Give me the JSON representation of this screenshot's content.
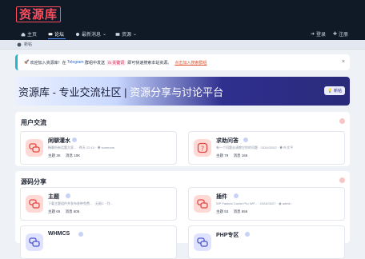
{
  "brand": {
    "logo": "资源库"
  },
  "header_actions": {
    "login": "登录",
    "register": "注册"
  },
  "nav": {
    "items": [
      {
        "label": "主页"
      },
      {
        "label": "论坛"
      },
      {
        "label": "最新消息"
      },
      {
        "label": "资源"
      }
    ]
  },
  "subbar": {
    "label": "新帖"
  },
  "notice": {
    "prefix": "欢迎加入资源库！在",
    "telegram": "Telegram",
    "middle": "群组中发送",
    "keyword": "/s 关键词",
    "suffix": "即可快速搜索本站资源。",
    "link": "点击加入搜索群组",
    "close": "×"
  },
  "banner": {
    "title_dark": "资源库 - 专业交流社区 | ",
    "title_light": "资源分享与讨论平台",
    "badge": "新帖"
  },
  "sections": [
    {
      "title": "用户交流",
      "cards": [
        {
          "name": "闲聊灌水",
          "desc": "畅聊所有话题大家...   · 昨天 22:10 · ◉ someone",
          "stats": [
            "主题 3K",
            "消息 10K"
          ]
        },
        {
          "name": "求助问答",
          "desc": "有一个问题去请教它你的问题 · 2024/02/02 · ◉ 叶文平",
          "stats": [
            "主题 79",
            "消息 166"
          ]
        }
      ]
    },
    {
      "title": "源码分享",
      "cards": [
        {
          "name": "主题",
          "desc": "下载主题组件并发布各种免费... · 无限C · 列...",
          "stats": [
            "主题 65",
            "消息 605"
          ]
        },
        {
          "name": "插件",
          "desc": "WP Fastest Cache Pro WP... · 2024/03/27 · ◉ admin",
          "stats": [
            "主题 53",
            "消息 656"
          ]
        },
        {
          "name": "WHMCS",
          "desc": "",
          "stats": []
        },
        {
          "name": "PHP专区",
          "desc": "",
          "stats": []
        }
      ]
    }
  ],
  "colors": {
    "accent": "#ff4d5e",
    "nav_bg": "#101a27",
    "icon_bg": "#ffd9d6",
    "icon_alt_bg": "#dfe3ff"
  }
}
